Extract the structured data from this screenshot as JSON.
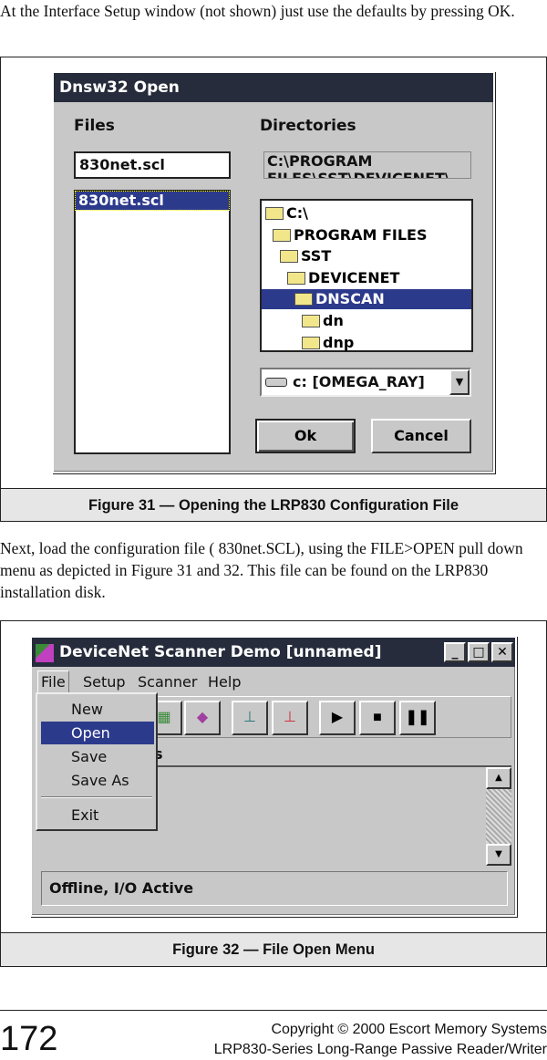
{
  "intro_text": "At the Interface Setup window (not shown) just use the defaults by pressing OK.",
  "figure31": {
    "caption": "Figure 31 — Opening the LRP830 Configuration File",
    "dialog": {
      "title": "Dnsw32 Open",
      "files_label": "Files",
      "directories_label": "Directories",
      "filename_value": "830net.scl",
      "files_list": [
        "830net.scl"
      ],
      "path_value": "C:\\PROGRAM",
      "path_value_line2": "FILES\\SST\\DEVICENET\\",
      "tree": [
        "C:\\",
        "PROGRAM FILES",
        "SST",
        "DEVICENET",
        "DNSCAN",
        "dn",
        "dnp"
      ],
      "selected_dir": "DNSCAN",
      "drive": "c: [OMEGA_RAY]",
      "ok_label": "Ok",
      "cancel_label": "Cancel"
    }
  },
  "body_text": "Next, load the configuration file ( 830net.SCL), using the FILE>OPEN pull down menu as depicted in Figure 31 and 32. This file can be found on the LRP830 installation disk.",
  "figure32": {
    "caption": "Figure 32 —  File Open Menu",
    "window": {
      "title": "DeviceNet Scanner Demo [unnamed]",
      "menu": [
        "File",
        "Setup",
        "Scanner",
        "Help"
      ],
      "file_menu": [
        "New",
        "Open",
        "Save",
        "Save As",
        "Exit"
      ],
      "selected_item": "Open",
      "partial_label": "s",
      "status": "Offline, I/O Active"
    }
  },
  "footer": {
    "page_number": "172",
    "copyright": "Copyright © 2000 Escort Memory Systems",
    "product": "LRP830-Series Long-Range Passive Reader/Writer"
  }
}
